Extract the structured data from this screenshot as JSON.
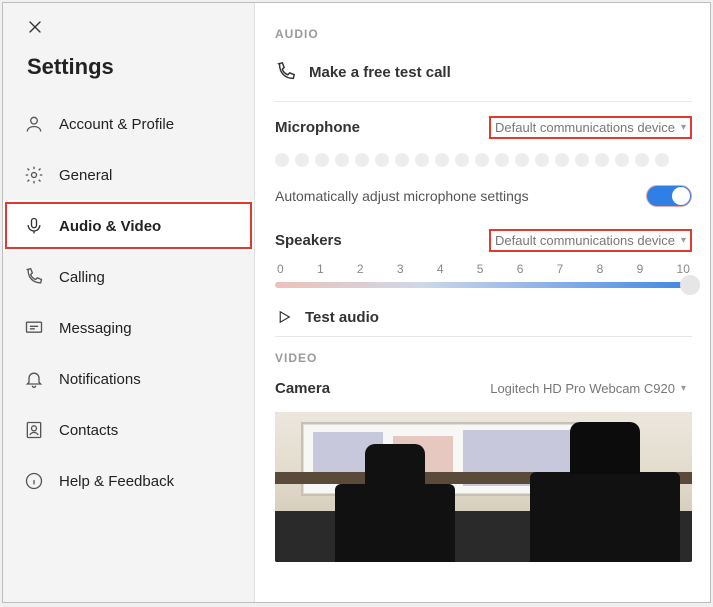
{
  "sidebar": {
    "title": "Settings",
    "items": [
      {
        "label": "Account & Profile",
        "icon": "person"
      },
      {
        "label": "General",
        "icon": "gear"
      },
      {
        "label": "Audio & Video",
        "icon": "mic",
        "active": true
      },
      {
        "label": "Calling",
        "icon": "phone"
      },
      {
        "label": "Messaging",
        "icon": "message"
      },
      {
        "label": "Notifications",
        "icon": "bell"
      },
      {
        "label": "Contacts",
        "icon": "contacts"
      },
      {
        "label": "Help & Feedback",
        "icon": "info"
      }
    ]
  },
  "audio": {
    "section": "AUDIO",
    "test_call": "Make a free test call",
    "microphone_label": "Microphone",
    "microphone_device": "Default communications device",
    "auto_adjust_label": "Automatically adjust microphone settings",
    "auto_adjust_on": true,
    "speakers_label": "Speakers",
    "speakers_device": "Default communications device",
    "scale": [
      "0",
      "1",
      "2",
      "3",
      "4",
      "5",
      "6",
      "7",
      "8",
      "9",
      "10"
    ],
    "speaker_level": 10,
    "test_audio": "Test audio"
  },
  "video": {
    "section": "VIDEO",
    "camera_label": "Camera",
    "camera_device": "Logitech HD Pro Webcam C920"
  }
}
